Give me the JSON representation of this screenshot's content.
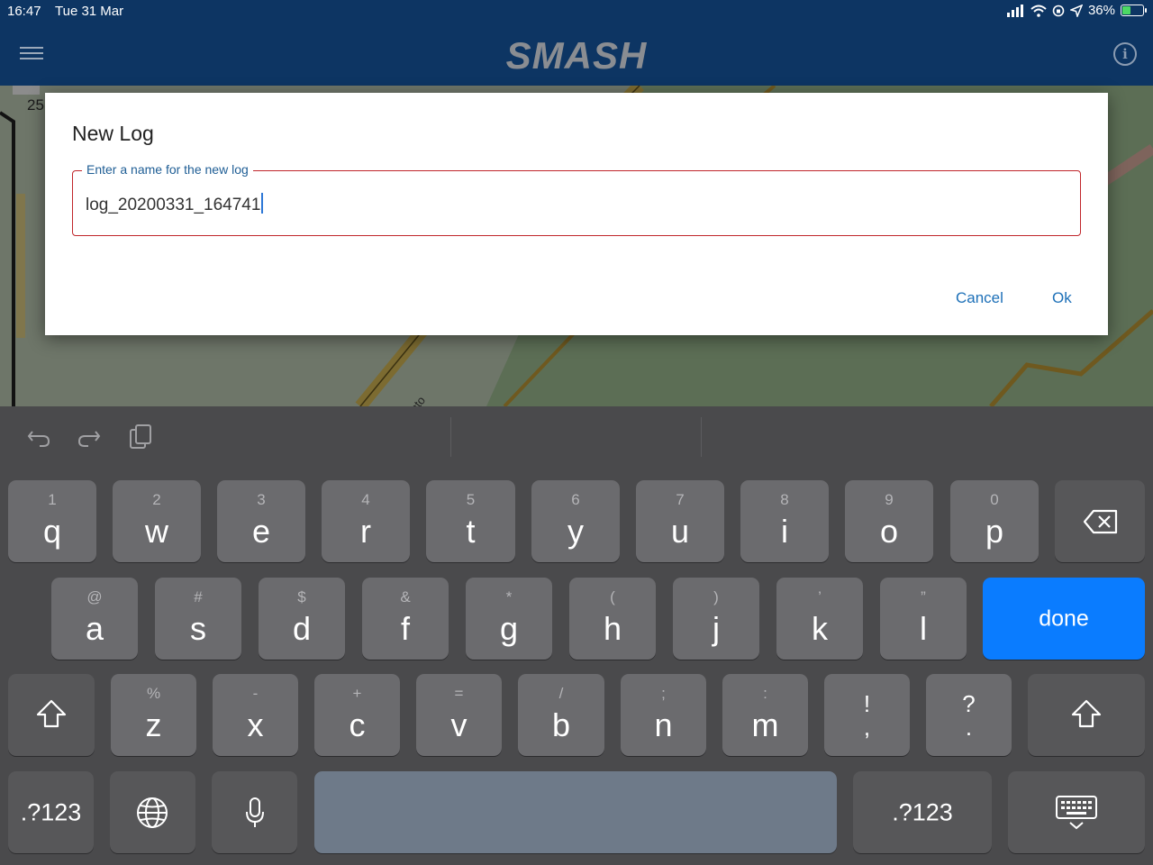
{
  "status": {
    "time": "16:47",
    "date": "Tue 31 Mar",
    "battery": "36%",
    "battery_level": 0.36
  },
  "appbar": {
    "title": "SMASH",
    "menu_icon": "hamburger-menu-icon",
    "info_icon": "info-icon",
    "info_glyph": "i"
  },
  "map": {
    "scale_text": "25",
    "road_label": "Be - Via Trento"
  },
  "dialog": {
    "title": "New Log",
    "field_label": "Enter a name for the new log",
    "field_value": "log_20200331_164741",
    "cancel_label": "Cancel",
    "ok_label": "Ok"
  },
  "keyboard": {
    "row1": [
      {
        "alt": "1",
        "main": "q"
      },
      {
        "alt": "2",
        "main": "w"
      },
      {
        "alt": "3",
        "main": "e"
      },
      {
        "alt": "4",
        "main": "r"
      },
      {
        "alt": "5",
        "main": "t"
      },
      {
        "alt": "6",
        "main": "y"
      },
      {
        "alt": "7",
        "main": "u"
      },
      {
        "alt": "8",
        "main": "i"
      },
      {
        "alt": "9",
        "main": "o"
      },
      {
        "alt": "0",
        "main": "p"
      }
    ],
    "row2": [
      {
        "alt": "@",
        "main": "a"
      },
      {
        "alt": "#",
        "main": "s"
      },
      {
        "alt": "$",
        "main": "d"
      },
      {
        "alt": "&",
        "main": "f"
      },
      {
        "alt": "*",
        "main": "g"
      },
      {
        "alt": "(",
        "main": "h"
      },
      {
        "alt": ")",
        "main": "j"
      },
      {
        "alt": "’",
        "main": "k"
      },
      {
        "alt": "”",
        "main": "l"
      }
    ],
    "row3": [
      {
        "alt": "%",
        "main": "z"
      },
      {
        "alt": "-",
        "main": "x"
      },
      {
        "alt": "+",
        "main": "c"
      },
      {
        "alt": "=",
        "main": "v"
      },
      {
        "alt": "/",
        "main": "b"
      },
      {
        "alt": ";",
        "main": "n"
      },
      {
        "alt": ":",
        "main": "m"
      }
    ],
    "row3_symbols": [
      {
        "top": "!",
        "bottom": ","
      },
      {
        "top": "?",
        "bottom": "."
      }
    ],
    "done_label": "done",
    "numbers_label": ".?123",
    "backspace_icon": "backspace-icon",
    "shift_icon": "shift-icon",
    "globe_icon": "globe-icon",
    "mic_icon": "microphone-icon",
    "hide_keyboard_icon": "keyboard-dismiss-icon",
    "undo_icon": "undo-icon",
    "redo_icon": "redo-icon",
    "paste_icon": "paste-icon"
  }
}
